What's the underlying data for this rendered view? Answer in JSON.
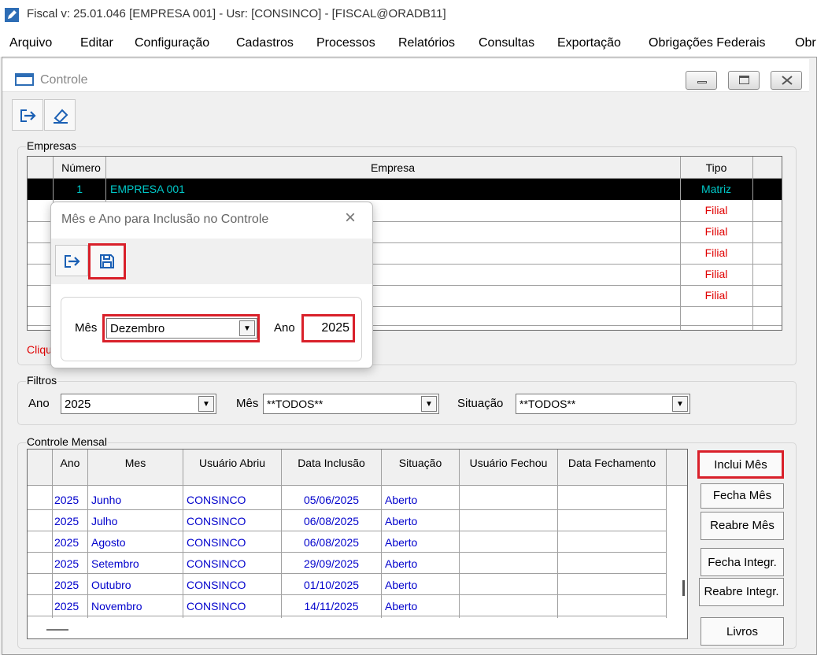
{
  "app": {
    "title": "Fiscal  v: 25.01.046  [EMPRESA 001] - Usr: [CONSINCO] - [FISCAL@ORADB11]"
  },
  "menu": [
    "Arquivo",
    "Editar",
    "Configuração",
    "Cadastros",
    "Processos",
    "Relatórios",
    "Consultas",
    "Exportação",
    "Obrigações Federais",
    "Obr"
  ],
  "window": {
    "title": "Controle",
    "icons": [
      "exit-icon",
      "eraser-icon"
    ]
  },
  "empresas": {
    "legend": "Empresas",
    "columns": [
      "Número",
      "Empresa",
      "Tipo"
    ],
    "rows": [
      {
        "numero": "1",
        "empresa": "EMPRESA 001",
        "tipo": "Matriz"
      },
      {
        "tipo": "Filial"
      },
      {
        "tipo": "Filial"
      },
      {
        "tipo": "Filial"
      },
      {
        "tipo": "Filial"
      },
      {
        "tipo": "Filial"
      }
    ],
    "hint_visible": "Cliqu"
  },
  "filtros": {
    "legend": "Filtros",
    "ano_label": "Ano",
    "ano_value": "2025",
    "mes_label": "Mês",
    "mes_value": "**TODOS**",
    "situacao_label": "Situação",
    "situacao_value": "**TODOS**"
  },
  "controle": {
    "legend": "Controle Mensal",
    "columns": [
      "Ano",
      "Mes",
      "Usuário Abriu",
      "Data Inclusão",
      "Situação",
      "Usuário Fechou",
      "Data Fechamento"
    ],
    "rows": [
      {
        "ano": "2025",
        "mes": "Junho",
        "usuario": "CONSINCO",
        "data": "05/06/2025",
        "situacao": "Aberto"
      },
      {
        "ano": "2025",
        "mes": "Julho",
        "usuario": "CONSINCO",
        "data": "06/08/2025",
        "situacao": "Aberto"
      },
      {
        "ano": "2025",
        "mes": "Agosto",
        "usuario": "CONSINCO",
        "data": "06/08/2025",
        "situacao": "Aberto"
      },
      {
        "ano": "2025",
        "mes": "Setembro",
        "usuario": "CONSINCO",
        "data": "29/09/2025",
        "situacao": "Aberto"
      },
      {
        "ano": "2025",
        "mes": "Outubro",
        "usuario": "CONSINCO",
        "data": "01/10/2025",
        "situacao": "Aberto"
      },
      {
        "ano": "2025",
        "mes": "Novembro",
        "usuario": "CONSINCO",
        "data": "14/11/2025",
        "situacao": "Aberto"
      }
    ]
  },
  "buttons": {
    "inclui_mes": "Inclui Mês",
    "fecha_mes": "Fecha Mês",
    "reabre_mes": "Reabre Mês",
    "fecha_integr": "Fecha Integr.",
    "reabre_integr": "Reabre Integr.",
    "livros": "Livros"
  },
  "dialog": {
    "title": "Mês e Ano para Inclusão no Controle",
    "close": "×",
    "mes_label": "Mês",
    "mes_value": "Dezembro",
    "ano_label": "Ano",
    "ano_value": "2025"
  },
  "colors": {
    "highlight": "#d9202a",
    "matriz": "#00c8c8",
    "filial": "#e00000",
    "link_text": "#0000cc"
  }
}
